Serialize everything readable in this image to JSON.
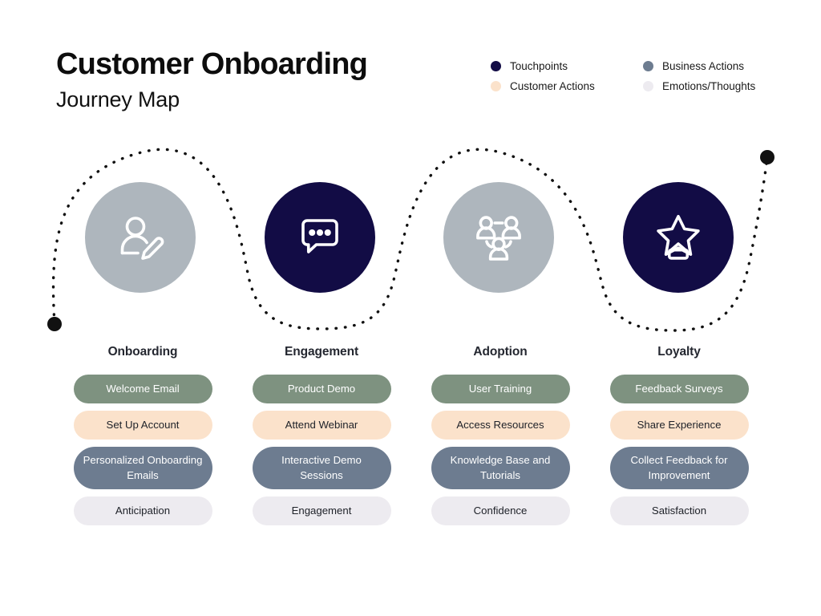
{
  "header": {
    "title": "Customer Onboarding",
    "subtitle": "Journey Map"
  },
  "legend": {
    "items": [
      {
        "label": "Touchpoints",
        "color": "#120c45",
        "icon": "legend-dot-icon"
      },
      {
        "label": "Business Actions",
        "color": "#6d7c90",
        "icon": "legend-dot-icon"
      },
      {
        "label": "Customer Actions",
        "color": "#fbe2cb",
        "icon": "legend-dot-icon"
      },
      {
        "label": "Emotions/Thoughts",
        "color": "#edebf0",
        "icon": "legend-dot-icon"
      }
    ]
  },
  "journey": {
    "path_color": "#111111",
    "start_marker_color": "#111111",
    "end_marker_color": "#111111",
    "stages": [
      {
        "name": "Onboarding",
        "circle_color": "#aeb6bd",
        "icon": "user-edit-icon",
        "rows": [
          {
            "type": "Touchpoints",
            "label": "Welcome Email",
            "color": "#7e9280",
            "text_color": "#ffffff",
            "lines": 1
          },
          {
            "type": "Customer Actions",
            "label": "Set Up Account",
            "color": "#fbe2cb",
            "text_color": "#20232a",
            "lines": 1
          },
          {
            "type": "Business Actions",
            "label": "Personalized Onboarding Emails",
            "color": "#6d7c90",
            "text_color": "#ffffff",
            "lines": 2
          },
          {
            "type": "Emotions/Thoughts",
            "label": "Anticipation",
            "color": "#edebf0",
            "text_color": "#20232a",
            "lines": 1
          }
        ]
      },
      {
        "name": "Engagement",
        "circle_color": "#120c45",
        "icon": "chat-bubble-icon",
        "rows": [
          {
            "type": "Touchpoints",
            "label": "Product Demo",
            "color": "#7e9280",
            "text_color": "#ffffff",
            "lines": 1
          },
          {
            "type": "Customer Actions",
            "label": "Attend Webinar",
            "color": "#fbe2cb",
            "text_color": "#20232a",
            "lines": 1
          },
          {
            "type": "Business Actions",
            "label": "Interactive Demo Sessions",
            "color": "#6d7c90",
            "text_color": "#ffffff",
            "lines": 2
          },
          {
            "type": "Emotions/Thoughts",
            "label": "Engagement",
            "color": "#edebf0",
            "text_color": "#20232a",
            "lines": 1
          }
        ]
      },
      {
        "name": "Adoption",
        "circle_color": "#aeb6bd",
        "icon": "people-network-icon",
        "rows": [
          {
            "type": "Touchpoints",
            "label": "User Training",
            "color": "#7e9280",
            "text_color": "#ffffff",
            "lines": 1
          },
          {
            "type": "Customer Actions",
            "label": "Access Resources",
            "color": "#fbe2cb",
            "text_color": "#20232a",
            "lines": 1
          },
          {
            "type": "Business Actions",
            "label": "Knowledge Base and Tutorials",
            "color": "#6d7c90",
            "text_color": "#ffffff",
            "lines": 2
          },
          {
            "type": "Emotions/Thoughts",
            "label": "Confidence",
            "color": "#edebf0",
            "text_color": "#20232a",
            "lines": 1
          }
        ]
      },
      {
        "name": "Loyalty",
        "circle_color": "#120c45",
        "icon": "star-trophy-icon",
        "rows": [
          {
            "type": "Touchpoints",
            "label": "Feedback Surveys",
            "color": "#7e9280",
            "text_color": "#ffffff",
            "lines": 1
          },
          {
            "type": "Customer Actions",
            "label": "Share Experience",
            "color": "#fbe2cb",
            "text_color": "#20232a",
            "lines": 1
          },
          {
            "type": "Business Actions",
            "label": "Collect Feedback for Improvement",
            "color": "#6d7c90",
            "text_color": "#ffffff",
            "lines": 2
          },
          {
            "type": "Emotions/Thoughts",
            "label": "Satisfaction",
            "color": "#edebf0",
            "text_color": "#20232a",
            "lines": 1
          }
        ]
      }
    ]
  }
}
